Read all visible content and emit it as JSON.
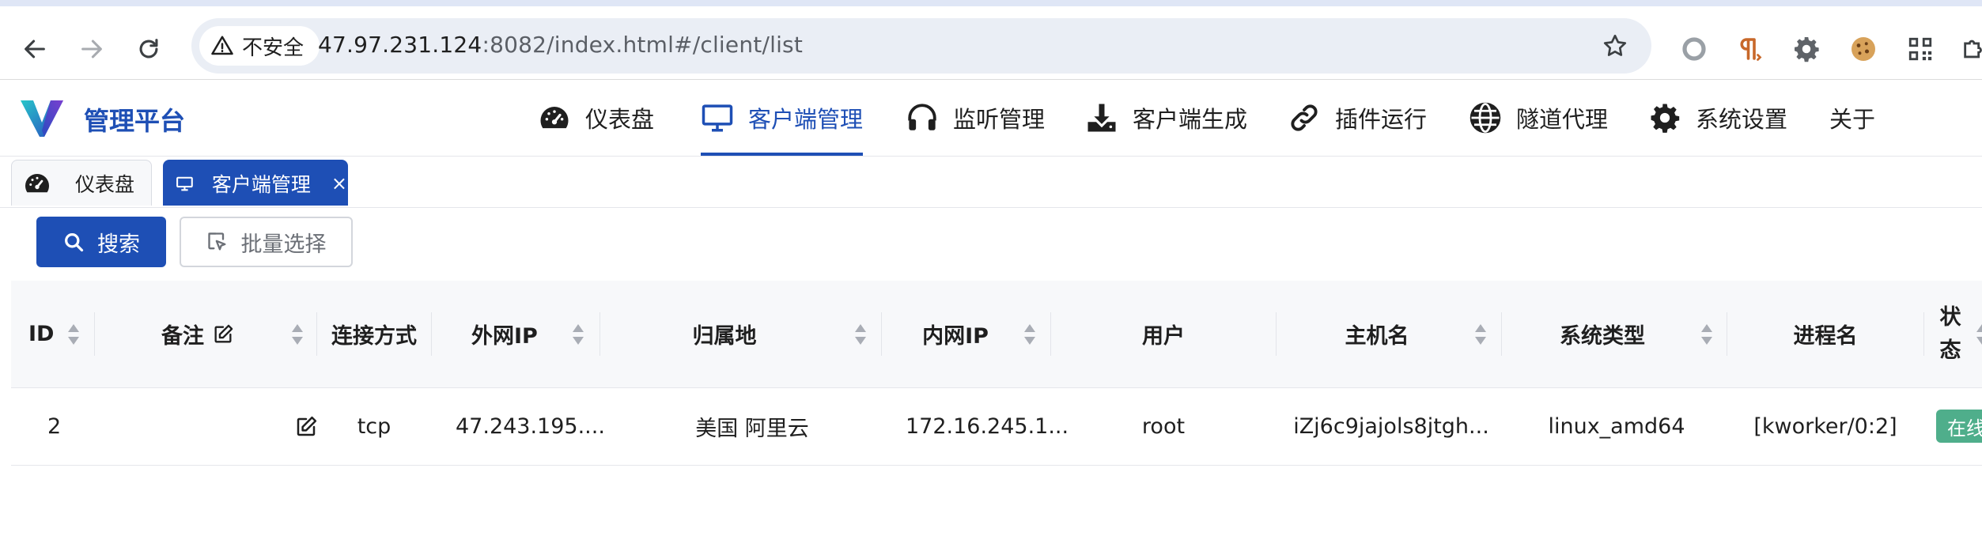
{
  "browser": {
    "security_label": "不安全",
    "url_host": "47.97.231.124",
    "url_path": ":8082/index.html#/client/list"
  },
  "app": {
    "brand": "管理平台",
    "nav": [
      {
        "label": "仪表盘",
        "icon": "dashboard-icon"
      },
      {
        "label": "客户端管理",
        "icon": "monitor-icon",
        "active": true
      },
      {
        "label": "监听管理",
        "icon": "headphones-icon"
      },
      {
        "label": "客户端生成",
        "icon": "download-icon"
      },
      {
        "label": "插件运行",
        "icon": "plugin-link-icon"
      },
      {
        "label": "隧道代理",
        "icon": "globe-icon"
      },
      {
        "label": "系统设置",
        "icon": "gear-icon"
      },
      {
        "label": "关于"
      }
    ]
  },
  "tabs": [
    {
      "label": "仪表盘",
      "icon": "dashboard-icon"
    },
    {
      "label": "客户端管理",
      "icon": "monitor-icon",
      "active": true,
      "close": "×"
    }
  ],
  "toolbar": {
    "search_label": "搜索",
    "batch_label": "批量选择"
  },
  "table": {
    "columns": [
      "ID",
      "备注",
      "连接方式",
      "外网IP",
      "归属地",
      "内网IP",
      "用户",
      "主机名",
      "系统类型",
      "进程名",
      "状态"
    ],
    "rows": [
      {
        "id": "2",
        "remark": "",
        "conn": "tcp",
        "public_ip": "47.243.195....",
        "location": "美国 阿里云",
        "private_ip": "172.16.245.1...",
        "user": "root",
        "hostname": "iZj6c9jajols8jtgh...",
        "os": "linux_amd64",
        "process": "[kworker/0:2]",
        "status": "在线"
      }
    ]
  },
  "colors": {
    "brand_blue": "#1e4fb5",
    "status_online": "#4fae8b"
  }
}
